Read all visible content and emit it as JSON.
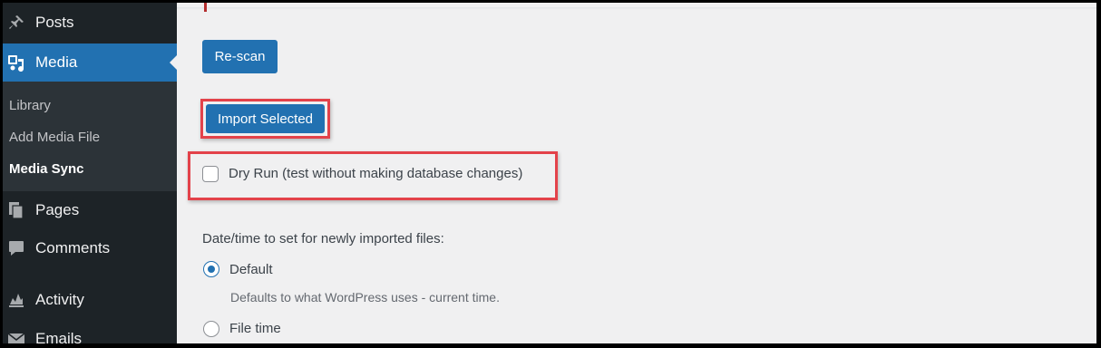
{
  "sidebar": {
    "items": [
      {
        "label": "Posts",
        "icon": "pin-icon"
      },
      {
        "label": "Media",
        "icon": "media-icon",
        "current": true
      },
      {
        "label": "Pages",
        "icon": "pages-icon"
      },
      {
        "label": "Comments",
        "icon": "comment-icon"
      },
      {
        "label": "Activity",
        "icon": "activity-icon"
      },
      {
        "label": "Emails",
        "icon": "mail-icon"
      }
    ],
    "submenu": [
      {
        "label": "Library"
      },
      {
        "label": "Add Media File"
      },
      {
        "label": "Media Sync",
        "active": true
      }
    ]
  },
  "main": {
    "rescan_label": "Re-scan",
    "import_label": "Import Selected",
    "dry_run_label": "Dry Run (test without making database changes)",
    "dry_run_checked": false,
    "date_heading": "Date/time to set for newly imported files:",
    "options": [
      {
        "label": "Default",
        "description": "Defaults to what WordPress uses - current time.",
        "checked": true
      },
      {
        "label": "File time",
        "checked": false
      }
    ]
  },
  "colors": {
    "sidebar_bg": "#1d2327",
    "submenu_bg": "#2c3338",
    "accent": "#2271b1",
    "highlight": "#e3424a",
    "content_bg": "#f0f0f1"
  }
}
